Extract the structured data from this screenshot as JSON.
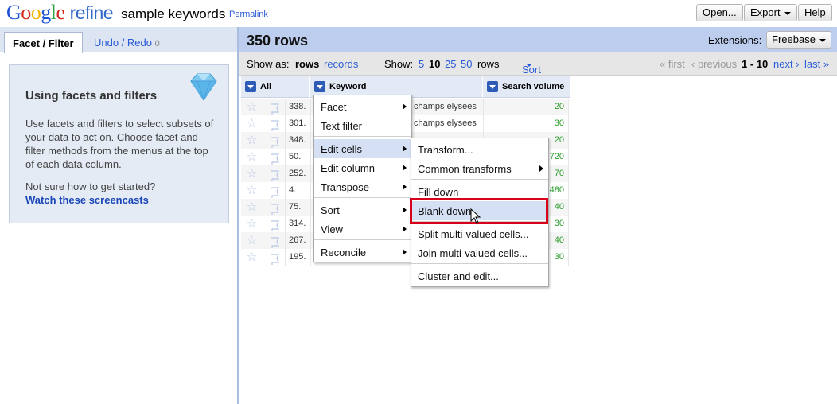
{
  "app": {
    "logo_letters": [
      "G",
      "o",
      "o",
      "g",
      "l",
      "e"
    ],
    "logo_suffix": "refine",
    "project_name": "sample keywords",
    "permalink": "Permalink",
    "buttons": {
      "open": "Open...",
      "export": "Export",
      "help": "Help"
    }
  },
  "left_panel": {
    "tabs": {
      "facet_filter": "Facet / Filter",
      "undo_redo": "Undo / Redo",
      "undo_count": "0"
    },
    "help": {
      "title": "Using facets and filters",
      "body": "Use facets and filters to select subsets of your data to act on. Choose facet and filter methods from the menus at the top of each data column.",
      "question": "Not sure how to get started?",
      "link": "Watch these screencasts"
    }
  },
  "right_panel": {
    "row_count": "350 rows",
    "extensions_label": "Extensions:",
    "extensions_button": "Freebase",
    "view_bar": {
      "show_as_label": "Show as:",
      "show_as_rows": "rows",
      "show_as_records": "records",
      "show_label": "Show:",
      "page_sizes": [
        "5",
        "10",
        "25",
        "50"
      ],
      "rows_label": "rows",
      "sort": "Sort",
      "first": "« first",
      "previous": "‹ previous",
      "range": "1 - 10",
      "next": "next ›",
      "last": "last »"
    },
    "columns": [
      "All",
      "Keyword",
      "Search volume"
    ],
    "rows": [
      {
        "num": "338.",
        "keyword": "champs elysees",
        "volume": "20"
      },
      {
        "num": "301.",
        "keyword": "champs elysees",
        "volume": "30"
      },
      {
        "num": "348.",
        "keyword": "",
        "volume": "20"
      },
      {
        "num": "50.",
        "keyword": "",
        "volume": "720"
      },
      {
        "num": "252.",
        "keyword": "",
        "volume": "70"
      },
      {
        "num": "4.",
        "keyword": "",
        "volume": "480"
      },
      {
        "num": "75.",
        "keyword": "",
        "volume": "40"
      },
      {
        "num": "314.",
        "keyword": "",
        "volume": "30"
      },
      {
        "num": "267.",
        "keyword": "",
        "volume": "40"
      },
      {
        "num": "195.",
        "keyword": "",
        "volume": "30"
      }
    ]
  },
  "column_menu": {
    "items": [
      "Facet",
      "Text filter",
      "Edit cells",
      "Edit column",
      "Transpose",
      "Sort",
      "View",
      "Reconcile"
    ],
    "highlighted": "Edit cells"
  },
  "edit_cells_submenu": {
    "items": [
      "Transform...",
      "Common transforms",
      "Fill down",
      "Blank down",
      "Split multi-valued cells...",
      "Join multi-valued cells...",
      "Cluster and edit..."
    ],
    "highlighted": "Blank down",
    "highlight_color": "#d9001b"
  },
  "icons": [
    "diamond-icon",
    "star-icon",
    "flag-icon",
    "dropdown-arrow-icon",
    "submenu-arrow-icon",
    "mouse-cursor-icon"
  ]
}
